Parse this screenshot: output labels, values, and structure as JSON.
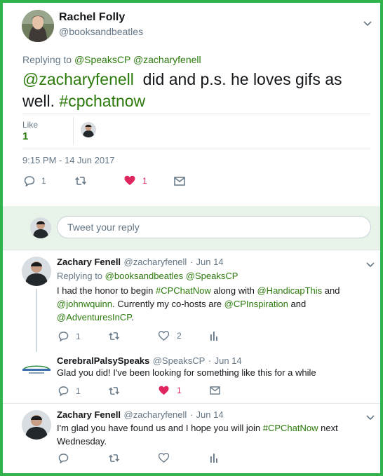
{
  "main_tweet": {
    "author_name": "Rachel Folly",
    "author_handle": "@booksandbeatles",
    "replying_prefix": "Replying to",
    "replying_to": [
      "@SpeaksCP",
      "@zacharyfenell"
    ],
    "text_mention": "@zacharyfenell",
    "text_body": "  did and p.s. he loves gifs as well.",
    "text_hashtag": "#cpchatnow",
    "likes_label": "Like",
    "likes_count": "1",
    "timestamp": "9:15 PM - 14 Jun 2017",
    "actions": {
      "reply_count": "1",
      "retweet_count": "",
      "like_count": "1"
    }
  },
  "composer": {
    "placeholder": "Tweet your reply"
  },
  "replies": [
    {
      "name": "Zachary Fenell",
      "handle": "@zacharyfenell",
      "date": "Jun 14",
      "replying_prefix": "Replying to",
      "replying_to": [
        "@booksandbeatles",
        "@SpeaksCP"
      ],
      "text_segments": [
        {
          "t": "I had the honor to begin ",
          "g": false
        },
        {
          "t": "#CPChatNow",
          "g": true
        },
        {
          "t": " along with ",
          "g": false
        },
        {
          "t": "@HandicapThis",
          "g": true
        },
        {
          "t": " and ",
          "g": false
        },
        {
          "t": "@johnwquinn",
          "g": true
        },
        {
          "t": ". Currently my co-hosts are ",
          "g": false
        },
        {
          "t": "@CPInspiration",
          "g": true
        },
        {
          "t": " and ",
          "g": false
        },
        {
          "t": "@AdventuresInCP",
          "g": true
        },
        {
          "t": ".",
          "g": false
        }
      ],
      "reply_count": "1",
      "retweet_count": "",
      "like_count": "2",
      "like_active": false
    },
    {
      "name": "CerebralPalsySpeaks",
      "handle": "@SpeaksCP",
      "date": "Jun 14",
      "text_segments": [
        {
          "t": "Glad you did! I've been looking for something like this for a while",
          "g": false
        }
      ],
      "reply_count": "1",
      "retweet_count": "",
      "like_count": "1",
      "like_active": true
    },
    {
      "name": "Zachary Fenell",
      "handle": "@zacharyfenell",
      "date": "Jun 14",
      "text_segments": [
        {
          "t": "I'm glad you have found us and I hope you will join ",
          "g": false
        },
        {
          "t": "#CPChatNow",
          "g": true
        },
        {
          "t": " next Wednesday.",
          "g": false
        }
      ],
      "reply_count": "",
      "retweet_count": "",
      "like_count": "",
      "like_active": false
    }
  ],
  "colors": {
    "frame_border": "#2fb34a",
    "link_green": "#2b7a0b",
    "like_red": "#e0245e",
    "composer_bg": "#e8f3ea"
  },
  "icons": [
    "reply-icon",
    "retweet-icon",
    "heart-icon",
    "dm-icon",
    "analytics-icon",
    "chevron-down-icon"
  ]
}
